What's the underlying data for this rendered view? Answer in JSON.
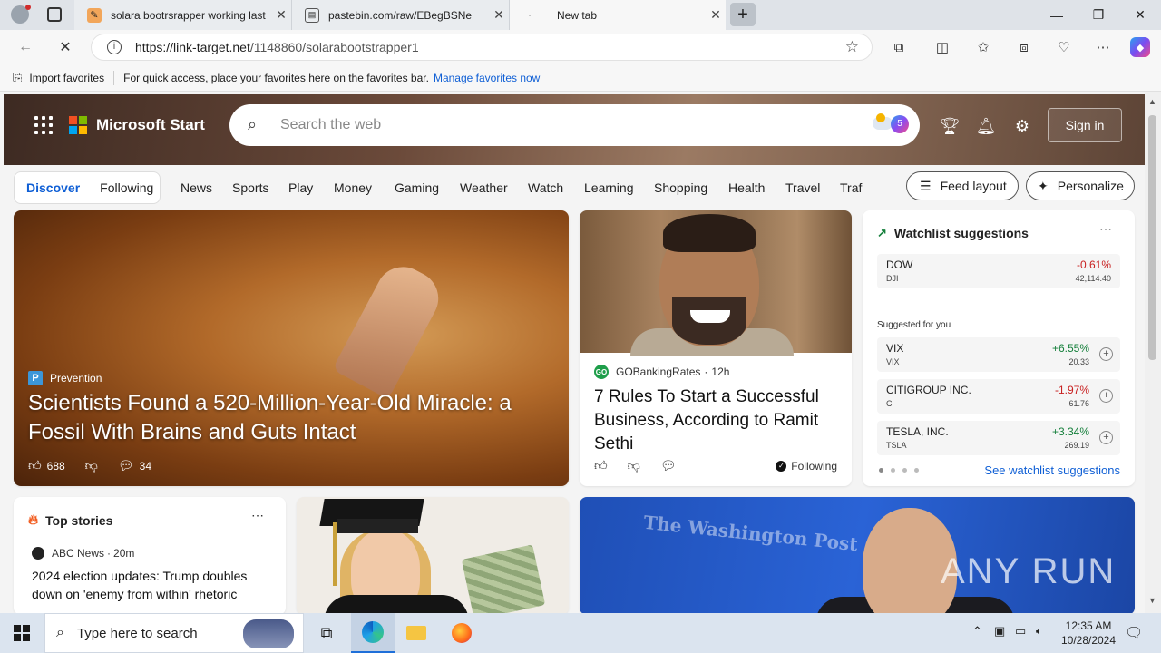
{
  "browser": {
    "tabs": [
      {
        "title": "solara bootrsrapper working last",
        "favicon": "script-icon"
      },
      {
        "title": "pastebin.com/raw/EBegBSNe",
        "favicon": "document-icon"
      },
      {
        "title": "New tab",
        "favicon": "loading-icon"
      }
    ],
    "url_host": "https://link-target.net",
    "url_path": "/1148860/solarabootstrapper1",
    "favorites_bar": {
      "import_label": "Import favorites",
      "hint": "For quick access, place your favorites here on the favorites bar.",
      "manage_link": "Manage favorites now"
    }
  },
  "page": {
    "brand": "Microsoft Start",
    "search_placeholder": "Search the web",
    "copilot_badge": "5",
    "sign_in": "Sign in",
    "feed_tabs": [
      "Discover",
      "Following"
    ],
    "nav_items": [
      "News",
      "Sports",
      "Play",
      "Money",
      "Gaming",
      "Weather",
      "Watch",
      "Learning",
      "Shopping",
      "Health",
      "Travel",
      "Traf"
    ],
    "feed_layout": "Feed layout",
    "personalize": "Personalize",
    "hero_story": {
      "source": "Prevention",
      "source_logo": "P",
      "headline": "Scientists Found a 520-Million-Year-Old Miracle: a Fossil With Brains and Guts Intact",
      "likes": "688",
      "comments": "34"
    },
    "second_story": {
      "source": "GOBankingRates",
      "source_logo": "GO",
      "time": "12h",
      "headline": "7 Rules To Start a Successful Business, According to Ramit Sethi",
      "following": "Following"
    },
    "watchlist": {
      "title": "Watchlist suggestions",
      "main": {
        "name": "DOW",
        "ticker": "DJI",
        "change": "-0.61%",
        "price": "42,114.40"
      },
      "suggested_label": "Suggested for you",
      "suggestions": [
        {
          "name": "VIX",
          "ticker": "VIX",
          "change": "+6.55%",
          "price": "20.33",
          "direction": "up"
        },
        {
          "name": "CITIGROUP INC.",
          "ticker": "C",
          "change": "-1.97%",
          "price": "61.76",
          "direction": "down"
        },
        {
          "name": "TESLA, INC.",
          "ticker": "TSLA",
          "change": "+3.34%",
          "price": "269.19",
          "direction": "up"
        }
      ],
      "see_link": "See watchlist suggestions"
    },
    "top_stories": {
      "title": "Top stories",
      "source": "ABC News",
      "time": "20m",
      "headline": "2024 election updates: Trump doubles down on 'enemy from within' rhetoric"
    },
    "bezos_card_masthead": "The Washington Post",
    "watermark": "ANY RUN"
  },
  "taskbar": {
    "search_placeholder": "Type here to search",
    "time": "12:35 AM",
    "date": "10/28/2024"
  },
  "colors": {
    "accent": "#0f5fd5",
    "positive": "#16803c",
    "negative": "#c82020"
  }
}
